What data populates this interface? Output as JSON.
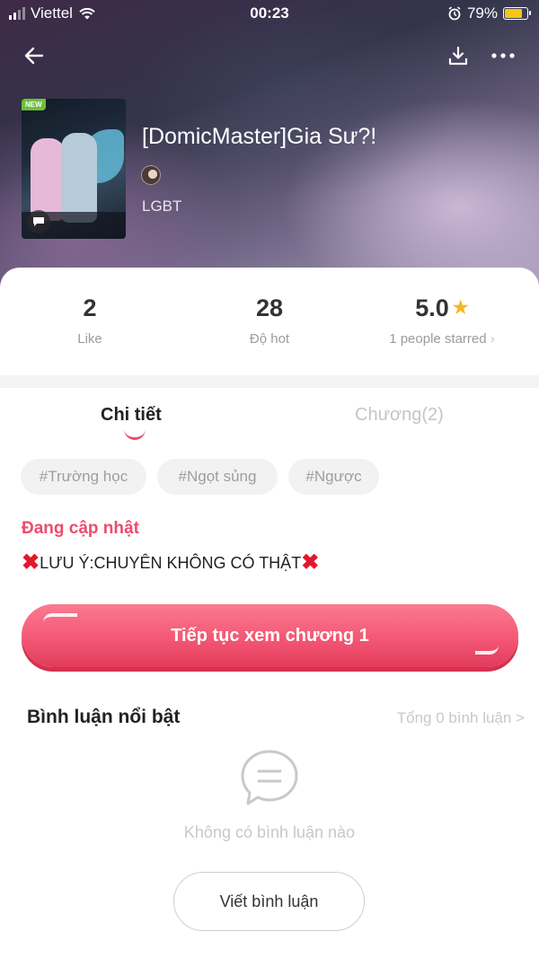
{
  "status_bar": {
    "carrier": "Viettel",
    "time": "00:23",
    "battery": "79%",
    "battery_level": 0.79
  },
  "header": {
    "back_icon": "arrow-left-icon",
    "download_icon": "download-icon",
    "more_icon": "more-dots-icon"
  },
  "book": {
    "new_badge": "NEW",
    "title": "[DomicMaster]Gia Sư?!",
    "category": "LGBT"
  },
  "stats": {
    "likes": {
      "value": "2",
      "label": "Like"
    },
    "hot": {
      "value": "28",
      "label": "Độ hot"
    },
    "rating": {
      "value": "5.0",
      "label": "1 people starred",
      "chevron": "›"
    }
  },
  "tabs": [
    {
      "label": "Chi tiết",
      "active": true
    },
    {
      "label": "Chương(2)",
      "active": false
    }
  ],
  "tags": [
    "#Trường học",
    "#Ngọt sủng",
    "#Ngược"
  ],
  "status": "Đang cập nhật",
  "note": "LƯU Ý:CHUYÊN KHÔNG CÓ THẬT",
  "cta": {
    "label": "Tiếp tục xem chương 1"
  },
  "comments": {
    "title": "Bình luận nổi bật",
    "total": "Tổng 0 bình luận >",
    "empty": "Không có bình luận nào",
    "write_button": "Viết bình luận"
  },
  "colors": {
    "accent": "#ee4a6c",
    "star": "#f5b921",
    "new_badge": "#6cbf3c"
  }
}
